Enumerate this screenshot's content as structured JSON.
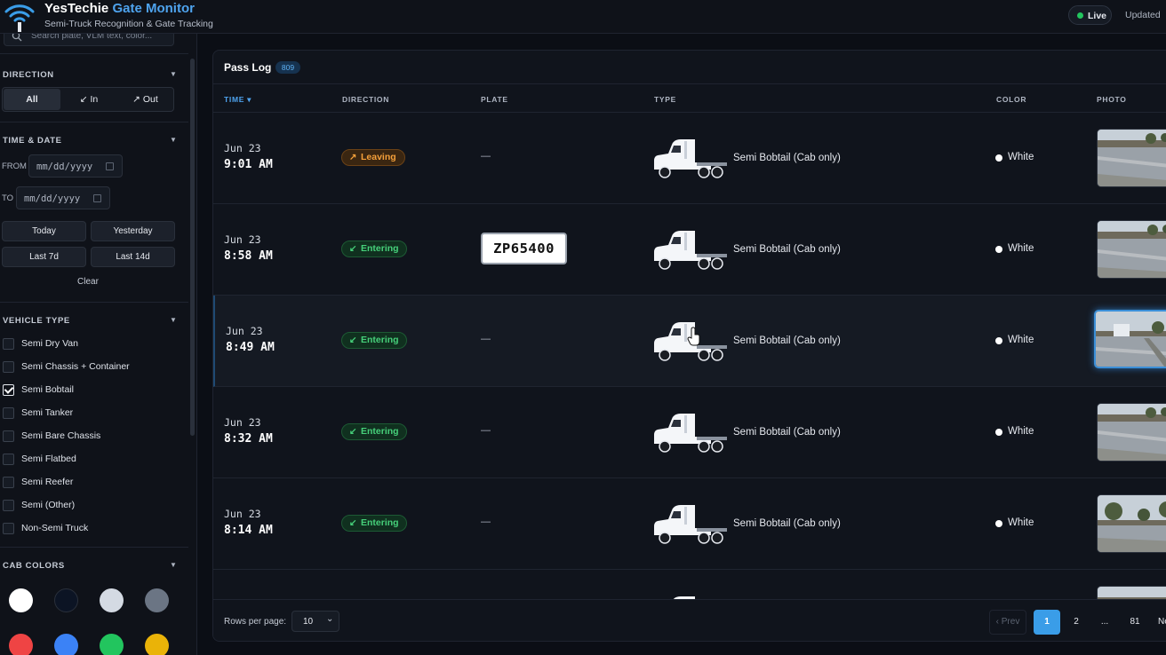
{
  "header": {
    "brand_main": "YesTechie",
    "brand_accent": "Gate Monitor",
    "subtitle": "Semi-Truck Recognition & Gate Tracking",
    "live_label": "Live",
    "updated_label": "Updated"
  },
  "sidebar": {
    "search_placeholder": "Search plate, VLM text, color...",
    "direction": {
      "title": "DIRECTION",
      "options": [
        "All",
        "↙ In",
        "↗ Out"
      ],
      "selected": "All"
    },
    "time_date": {
      "title": "TIME & DATE",
      "from_label": "FROM",
      "to_label": "TO",
      "date_placeholder": "mm/dd/yyyy",
      "quick": [
        "Today",
        "Yesterday",
        "Last 7d",
        "Last 14d"
      ],
      "clear_label": "Clear"
    },
    "vehicle_type": {
      "title": "VEHICLE TYPE",
      "items": [
        {
          "label": "Semi Dry Van",
          "checked": false
        },
        {
          "label": "Semi Chassis + Container",
          "checked": false
        },
        {
          "label": "Semi Bobtail",
          "checked": true
        },
        {
          "label": "Semi Tanker",
          "checked": false
        },
        {
          "label": "Semi Bare Chassis",
          "checked": false
        },
        {
          "label": "Semi Flatbed",
          "checked": false
        },
        {
          "label": "Semi Reefer",
          "checked": false
        },
        {
          "label": "Semi (Other)",
          "checked": false
        },
        {
          "label": "Non-Semi Truck",
          "checked": false
        }
      ]
    },
    "cab_colors": {
      "title": "CAB COLORS",
      "swatches": [
        "#ffffff",
        "#0c1424",
        "#d4dae3",
        "#6b7584",
        "#ef4444",
        "#3b82f6",
        "#22c55e",
        "#eab308"
      ]
    }
  },
  "pass_log": {
    "title": "Pass Log",
    "count": "809",
    "columns": [
      "TIME ▾",
      "DIRECTION",
      "PLATE",
      "TYPE",
      "COLOR",
      "PHOTO"
    ],
    "rows": [
      {
        "date": "Jun 23",
        "time": "9:01 AM",
        "direction": "Leaving",
        "arrow": "↗",
        "plate": "",
        "type": "Semi Bobtail (Cab only)",
        "color": "White"
      },
      {
        "date": "Jun 23",
        "time": "8:58 AM",
        "direction": "Entering",
        "arrow": "↙",
        "plate": "ZP65400",
        "type": "Semi Bobtail (Cab only)",
        "color": "White"
      },
      {
        "date": "Jun 23",
        "time": "8:49 AM",
        "direction": "Entering",
        "arrow": "↙",
        "plate": "",
        "type": "Semi Bobtail (Cab only)",
        "color": "White"
      },
      {
        "date": "Jun 23",
        "time": "8:32 AM",
        "direction": "Entering",
        "arrow": "↙",
        "plate": "",
        "type": "Semi Bobtail (Cab only)",
        "color": "White"
      },
      {
        "date": "Jun 23",
        "time": "8:14 AM",
        "direction": "Entering",
        "arrow": "↙",
        "plate": "",
        "type": "Semi Bobtail (Cab only)",
        "color": "White"
      }
    ],
    "empty_plate": "—",
    "pager": {
      "rows_per_page_label": "Rows per page:",
      "rows_per_page_value": "10",
      "prev_label": "‹ Prev",
      "pages": [
        "1",
        "2",
        "...",
        "81"
      ],
      "current": "1",
      "next_label": "Next ›"
    }
  },
  "colors": {
    "accent": "#3a9de8",
    "leaving": "#f5a03a",
    "entering": "#46d07a",
    "live": "#22c55e"
  }
}
